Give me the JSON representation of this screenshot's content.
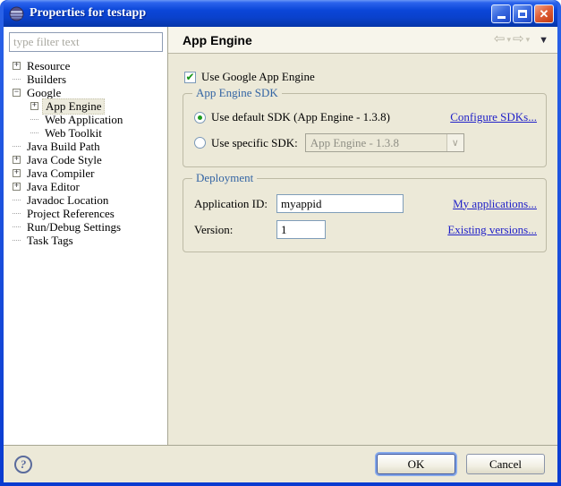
{
  "window": {
    "title": "Properties for testapp"
  },
  "titlebar_icons": {
    "close_glyph": "✕"
  },
  "filter": {
    "placeholder": "type filter text"
  },
  "tree": {
    "items": [
      {
        "label": "Resource",
        "level": 0,
        "toggle": "plus",
        "selected": false
      },
      {
        "label": "Builders",
        "level": 0,
        "toggle": "none",
        "selected": false
      },
      {
        "label": "Google",
        "level": 0,
        "toggle": "minus",
        "selected": false
      },
      {
        "label": "App Engine",
        "level": 1,
        "toggle": "plus",
        "selected": true
      },
      {
        "label": "Web Application",
        "level": 1,
        "toggle": "none",
        "selected": false
      },
      {
        "label": "Web Toolkit",
        "level": 1,
        "toggle": "none",
        "selected": false
      },
      {
        "label": "Java Build Path",
        "level": 0,
        "toggle": "none",
        "selected": false
      },
      {
        "label": "Java Code Style",
        "level": 0,
        "toggle": "plus",
        "selected": false
      },
      {
        "label": "Java Compiler",
        "level": 0,
        "toggle": "plus",
        "selected": false
      },
      {
        "label": "Java Editor",
        "level": 0,
        "toggle": "plus",
        "selected": false
      },
      {
        "label": "Javadoc Location",
        "level": 0,
        "toggle": "none",
        "selected": false
      },
      {
        "label": "Project References",
        "level": 0,
        "toggle": "none",
        "selected": false
      },
      {
        "label": "Run/Debug Settings",
        "level": 0,
        "toggle": "none",
        "selected": false
      },
      {
        "label": "Task Tags",
        "level": 0,
        "toggle": "none",
        "selected": false
      }
    ]
  },
  "header": {
    "title": "App Engine",
    "back_arrow": "⇦",
    "forward_arrow": "⇨",
    "caret": "▾",
    "view_menu": "▼"
  },
  "main": {
    "use_gae_checkbox": {
      "label": "Use Google App Engine",
      "checked": true,
      "check_glyph": "✔"
    },
    "sdk_group": {
      "title": "App Engine SDK",
      "default_radio_label": "Use default SDK (App Engine - 1.3.8)",
      "default_radio_selected": true,
      "configure_link": "Configure SDKs...",
      "specific_radio_label": "Use specific SDK:",
      "specific_radio_selected": false,
      "sdk_combo_value": "App Engine - 1.3.8",
      "sdk_combo_arrow": "∨"
    },
    "deployment_group": {
      "title": "Deployment",
      "app_id_label": "Application ID:",
      "app_id_value": "myappid",
      "my_applications_link": "My applications...",
      "version_label": "Version:",
      "version_value": "1",
      "existing_versions_link": "Existing versions..."
    }
  },
  "footer": {
    "ok_label": "OK",
    "cancel_label": "Cancel",
    "help_glyph": "?"
  },
  "colors": {
    "titlebar_blue": "#0b46d8",
    "dialog_bg": "#ece9d8",
    "group_title_blue": "#3465a4",
    "link_blue": "#2121c8",
    "check_green": "#149414",
    "close_red": "#e0603a"
  }
}
